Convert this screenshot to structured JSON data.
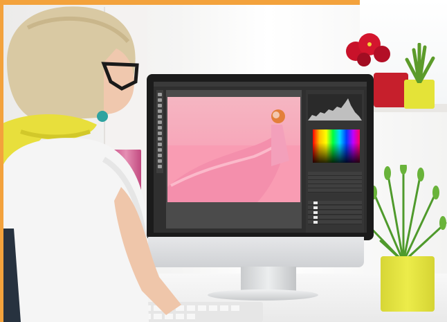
{
  "scene": {
    "accent_color": "#f3a23c",
    "wall_color": "#f3f3f2",
    "pot_colors": [
      "#c61f2c",
      "#e4e338",
      "#e4e338"
    ],
    "photo_tint": "#f7a9bb"
  },
  "monitor": {
    "app": {
      "menu_items": [
        "",
        "",
        "",
        "",
        "",
        "",
        "",
        "",
        ""
      ],
      "panels": [
        "",
        "",
        "",
        ""
      ],
      "tools": [
        "move-tool-icon",
        "marquee-tool-icon",
        "lasso-tool-icon",
        "magic-wand-icon",
        "crop-tool-icon",
        "eyedropper-icon",
        "brush-tool-icon",
        "eraser-tool-icon",
        "gradient-tool-icon",
        "dodge-tool-icon",
        "pen-tool-icon",
        "type-tool-icon",
        "shape-tool-icon",
        "hand-tool-icon",
        "zoom-tool-icon"
      ]
    }
  }
}
